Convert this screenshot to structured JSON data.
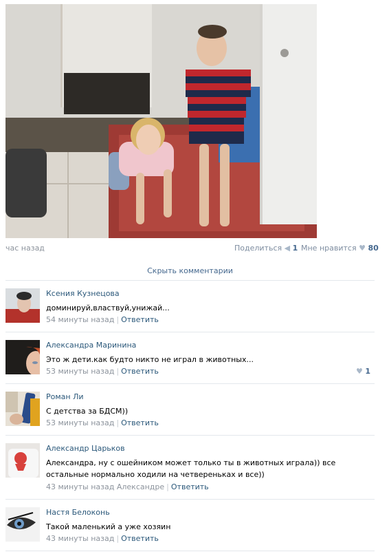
{
  "post": {
    "time": "час назад",
    "share_label": "Поделиться",
    "share_count": "1",
    "like_label": "Мне нравится",
    "like_count": "80",
    "hide_comments": "Скрыть комментарии"
  },
  "icons": {
    "share": "megaphone-icon",
    "like": "heart-icon"
  },
  "colors": {
    "link": "#2b587a",
    "meta": "#8c939c",
    "separator": "#e3e8ec"
  },
  "comments": [
    {
      "author": "Ксения Кузнецова",
      "text": "доминируй,властвуй,унижай...",
      "time": "54 минуты назад",
      "reply": "Ответить",
      "likes": ""
    },
    {
      "author": "Александра Маринина",
      "text": "Это ж дети.как будто никто не играл в животных...",
      "time": "53 минуты назад",
      "reply": "Ответить",
      "likes": "1"
    },
    {
      "author": "Роман Ли",
      "text": "С детства за БДСМ))",
      "time": "53 минуты назад",
      "reply": "Ответить",
      "likes": ""
    },
    {
      "author": "Александр Царьков",
      "text": "Александра, ну с ошейником может только ты в животных играла)) все остальные нормально ходили на четвереньках и все))",
      "time": "43 минуты назад Александре",
      "reply": "Ответить",
      "likes": ""
    },
    {
      "author": "Настя Белоконь",
      "text": "Такой маленький а уже хозяин",
      "time": "43 минуты назад",
      "reply": "Ответить",
      "likes": ""
    }
  ]
}
